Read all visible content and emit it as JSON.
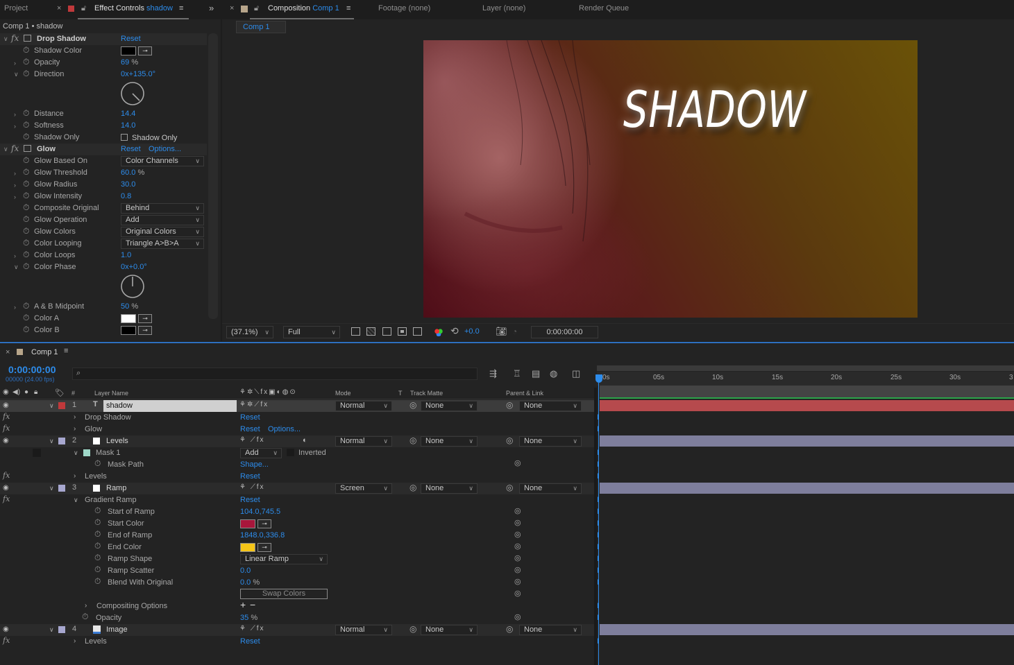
{
  "panels": {
    "project_tab": "Project",
    "effect_controls_tab": "Effect Controls",
    "effect_controls_layer": "shadow",
    "composition_tab": "Composition",
    "composition_name": "Comp 1",
    "footage_tab": "Footage",
    "footage_value": "(none)",
    "layer_tab": "Layer",
    "layer_value": "(none)",
    "render_queue_tab": "Render Queue",
    "timeline_tab": "Comp 1"
  },
  "effect_controls": {
    "breadcrumb": "Comp 1 • shadow",
    "drop_shadow": {
      "name": "Drop Shadow",
      "reset": "Reset",
      "shadow_color_label": "Shadow Color",
      "opacity_label": "Opacity",
      "opacity_value": "69",
      "opacity_unit": "%",
      "direction_label": "Direction",
      "direction_value": "0x+135.0°",
      "distance_label": "Distance",
      "distance_value": "14.4",
      "softness_label": "Softness",
      "softness_value": "14.0",
      "shadow_only_label": "Shadow Only",
      "shadow_only_checkbox": "Shadow Only"
    },
    "glow": {
      "name": "Glow",
      "reset": "Reset",
      "options": "Options...",
      "based_on_label": "Glow Based On",
      "based_on_value": "Color Channels",
      "threshold_label": "Glow Threshold",
      "threshold_value": "60.0",
      "threshold_unit": "%",
      "radius_label": "Glow Radius",
      "radius_value": "30.0",
      "intensity_label": "Glow Intensity",
      "intensity_value": "0.8",
      "composite_label": "Composite Original",
      "composite_value": "Behind",
      "operation_label": "Glow Operation",
      "operation_value": "Add",
      "colors_label": "Glow Colors",
      "colors_value": "Original Colors",
      "looping_label": "Color Looping",
      "looping_value": "Triangle A>B>A",
      "loops_label": "Color Loops",
      "loops_value": "1.0",
      "phase_label": "Color Phase",
      "phase_value": "0x+0.0°",
      "midpoint_label": "A & B Midpoint",
      "midpoint_value": "50",
      "midpoint_unit": "%",
      "color_a_label": "Color A",
      "color_b_label": "Color B"
    }
  },
  "comp_viewer": {
    "title_text": "SHADOW",
    "zoom": "(37.1%)",
    "resolution": "Full",
    "exposure": "+0.0",
    "timecode": "0:00:00:00"
  },
  "timeline": {
    "current_time": "0:00:00:00",
    "frame_info": "00000 (24.00 fps)",
    "search_placeholder": "",
    "col_num": "#",
    "col_layer_name": "Layer Name",
    "col_mode": "Mode",
    "col_t": "T",
    "col_track_matte": "Track Matte",
    "col_parent": "Parent & Link",
    "ruler": [
      "0s",
      "05s",
      "10s",
      "15s",
      "20s",
      "25s",
      "30s",
      "3"
    ],
    "layers": {
      "l1": {
        "num": "1",
        "name": "shadow",
        "mode": "Normal",
        "matte": "None",
        "parent": "None",
        "fx1": "Drop Shadow",
        "fx1_reset": "Reset",
        "fx2": "Glow",
        "fx2_reset": "Reset",
        "fx2_options": "Options..."
      },
      "l2": {
        "num": "2",
        "name": "Levels",
        "mode": "Normal",
        "matte": "None",
        "parent": "None",
        "mask": "Mask 1",
        "mask_mode": "Add",
        "inverted": "Inverted",
        "mask_path": "Mask Path",
        "mask_path_value": "Shape...",
        "fx1": "Levels",
        "fx1_reset": "Reset"
      },
      "l3": {
        "num": "3",
        "name": "Ramp",
        "mode": "Screen",
        "matte": "None",
        "parent": "None",
        "fx1": "Gradient Ramp",
        "fx1_reset": "Reset",
        "start_of_ramp": "Start of Ramp",
        "start_of_ramp_value": "104.0,745.5",
        "start_color": "Start Color",
        "end_of_ramp": "End of Ramp",
        "end_of_ramp_value": "1848.0,336.8",
        "end_color": "End Color",
        "ramp_shape": "Ramp Shape",
        "ramp_shape_value": "Linear Ramp",
        "ramp_scatter": "Ramp Scatter",
        "ramp_scatter_value": "0.0",
        "blend": "Blend With Original",
        "blend_value": "0.0",
        "blend_unit": "%",
        "swap": "Swap Colors",
        "compositing": "Compositing Options",
        "opacity": "Opacity",
        "opacity_value": "35",
        "opacity_unit": "%"
      },
      "l4": {
        "num": "4",
        "name": "Image",
        "mode": "Normal",
        "matte": "None",
        "parent": "None",
        "fx1": "Levels",
        "fx1_reset": "Reset"
      }
    }
  },
  "colors": {
    "accent_blue": "#2d8ceb",
    "layer1_label": "#c0393b",
    "layer_label_lavender": "#a7a7cf",
    "start_color": "#a8163b",
    "end_color": "#f5c518",
    "shadow_color": "#000000",
    "color_a": "#ffffff",
    "color_b": "#000000"
  }
}
